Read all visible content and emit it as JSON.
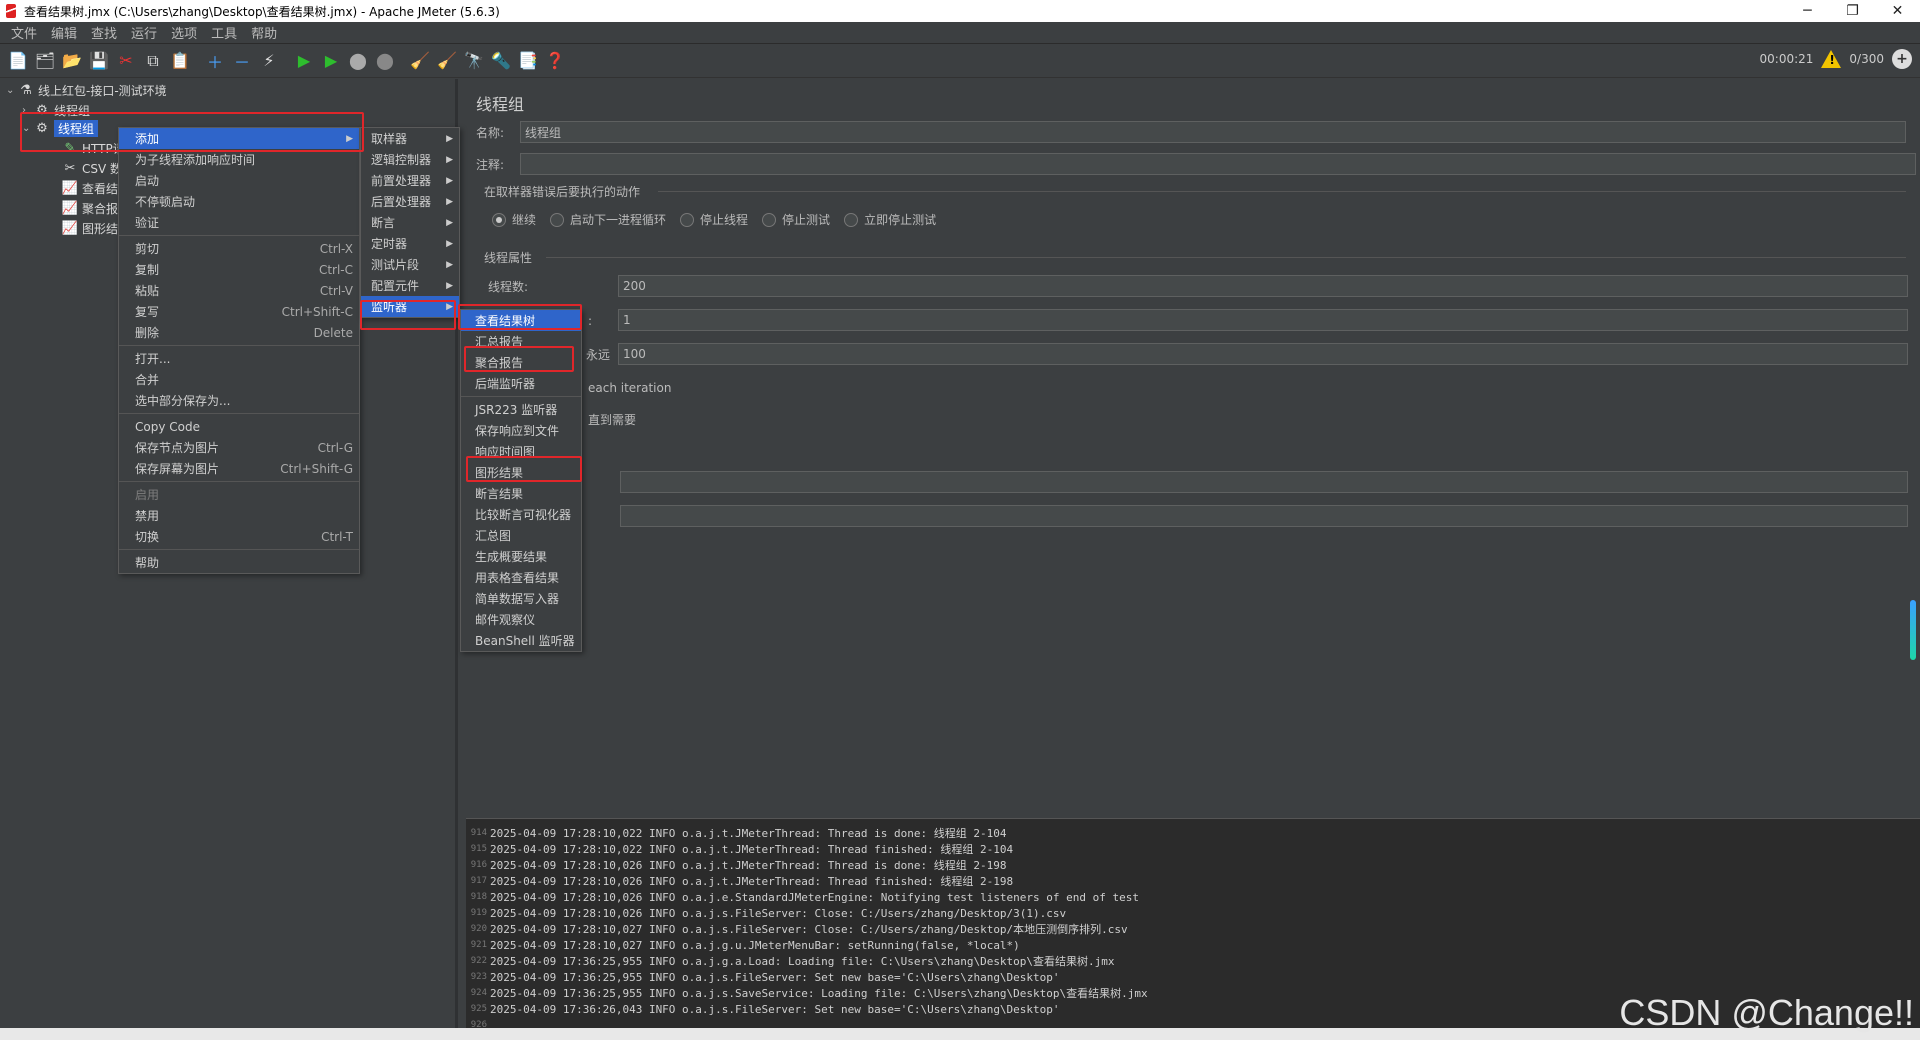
{
  "window": {
    "title": "查看结果树.jmx (C:\\Users\\zhang\\Desktop\\查看结果树.jmx) - Apache JMeter (5.6.3)",
    "min": "─",
    "max": "❐",
    "close": "✕"
  },
  "menubar": [
    "文件",
    "编辑",
    "查找",
    "运行",
    "选项",
    "工具",
    "帮助"
  ],
  "toolbar": {
    "timer": "00:00:21",
    "threads": "0/300"
  },
  "tree": {
    "root": "线上红包-接口-测试环境",
    "group1": "线程组",
    "group2": "线程组",
    "child_http": "HTTP请",
    "child_csv": "CSV 数",
    "child_view": "查看结",
    "child_agg": "聚合报",
    "child_graph": "图形结"
  },
  "panel": {
    "title": "线程组",
    "name_label": "名称:",
    "name_value": "线程组",
    "comment_label": "注释:",
    "error_section": "在取样器错误后要执行的动作",
    "radios": [
      "继续",
      "启动下一进程循环",
      "停止线程",
      "停止测试",
      "立即停止测试"
    ],
    "thread_section": "线程属性",
    "threads_label": "线程数:",
    "threads_value": "200",
    "ramp_label_partial": "）:",
    "ramp_value": "1",
    "forever_label": "永远",
    "loop_value": "100",
    "each_iter": "each iteration",
    "until_needed": "直到需要"
  },
  "context_menu": {
    "items": [
      {
        "label": "添加",
        "shortcut": ""
      },
      {
        "label": "为子线程添加响应时间",
        "shortcut": ""
      },
      {
        "label": "启动",
        "shortcut": ""
      },
      {
        "label": "不停顿启动",
        "shortcut": ""
      },
      {
        "label": "验证",
        "shortcut": ""
      },
      {
        "label": "剪切",
        "shortcut": "Ctrl-X"
      },
      {
        "label": "复制",
        "shortcut": "Ctrl-C"
      },
      {
        "label": "粘贴",
        "shortcut": "Ctrl-V"
      },
      {
        "label": "复写",
        "shortcut": "Ctrl+Shift-C"
      },
      {
        "label": "删除",
        "shortcut": "Delete"
      },
      {
        "label": "打开...",
        "shortcut": ""
      },
      {
        "label": "合并",
        "shortcut": ""
      },
      {
        "label": "选中部分保存为...",
        "shortcut": ""
      },
      {
        "label": "Copy Code",
        "shortcut": ""
      },
      {
        "label": "保存节点为图片",
        "shortcut": "Ctrl-G"
      },
      {
        "label": "保存屏幕为图片",
        "shortcut": "Ctrl+Shift-G"
      },
      {
        "label": "启用",
        "shortcut": ""
      },
      {
        "label": "禁用",
        "shortcut": ""
      },
      {
        "label": "切换",
        "shortcut": "Ctrl-T"
      },
      {
        "label": "帮助",
        "shortcut": ""
      }
    ]
  },
  "add_menu": [
    "取样器",
    "逻辑控制器",
    "前置处理器",
    "后置处理器",
    "断言",
    "定时器",
    "测试片段",
    "配置元件",
    "监听器"
  ],
  "listener_menu": [
    "查看结果树",
    "汇总报告",
    "聚合报告",
    "后端监听器",
    "JSR223 监听器",
    "保存响应到文件",
    "响应时间图",
    "图形结果",
    "断言结果",
    "比较断言可视化器",
    "汇总图",
    "生成概要结果",
    "用表格查看结果",
    "简单数据写入器",
    "邮件观察仪",
    "BeanShell 监听器"
  ],
  "log": [
    {
      "ln": "914",
      "text": "2025-04-09 17:28:10,022 INFO o.a.j.t.JMeterThread: Thread is done: 线程组 2-104"
    },
    {
      "ln": "915",
      "text": "2025-04-09 17:28:10,022 INFO o.a.j.t.JMeterThread: Thread finished: 线程组 2-104"
    },
    {
      "ln": "916",
      "text": "2025-04-09 17:28:10,026 INFO o.a.j.t.JMeterThread: Thread is done: 线程组 2-198"
    },
    {
      "ln": "917",
      "text": "2025-04-09 17:28:10,026 INFO o.a.j.t.JMeterThread: Thread finished: 线程组 2-198"
    },
    {
      "ln": "918",
      "text": "2025-04-09 17:28:10,026 INFO o.a.j.e.StandardJMeterEngine: Notifying test listeners of end of test"
    },
    {
      "ln": "919",
      "text": "2025-04-09 17:28:10,026 INFO o.a.j.s.FileServer: Close: C:/Users/zhang/Desktop/3(1).csv"
    },
    {
      "ln": "920",
      "text": "2025-04-09 17:28:10,027 INFO o.a.j.s.FileServer: Close: C:/Users/zhang/Desktop/本地压测倒序排列.csv"
    },
    {
      "ln": "921",
      "text": "2025-04-09 17:28:10,027 INFO o.a.j.g.u.JMeterMenuBar: setRunning(false, *local*)"
    },
    {
      "ln": "922",
      "text": "2025-04-09 17:36:25,955 INFO o.a.j.g.a.Load: Loading file: C:\\Users\\zhang\\Desktop\\查看结果树.jmx"
    },
    {
      "ln": "923",
      "text": "2025-04-09 17:36:25,955 INFO o.a.j.s.FileServer: Set new base='C:\\Users\\zhang\\Desktop'"
    },
    {
      "ln": "924",
      "text": "2025-04-09 17:36:25,955 INFO o.a.j.s.SaveService: Loading file: C:\\Users\\zhang\\Desktop\\查看结果树.jmx"
    },
    {
      "ln": "925",
      "text": "2025-04-09 17:36:26,043 INFO o.a.j.s.FileServer: Set new base='C:\\Users\\zhang\\Desktop'"
    },
    {
      "ln": "926",
      "text": ""
    }
  ],
  "watermark": "CSDN @Change!!"
}
